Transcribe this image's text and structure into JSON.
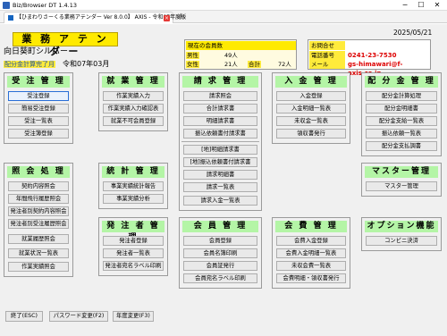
{
  "window": {
    "title": "Biz/Browser DT 1.4.13",
    "tab_label": "【ひまわりさーくる業務アテンダー Ver 8.0.0】 AXIS  -  令和07年度版",
    "new_tab": "+",
    "min": "─",
    "max": "☐",
    "close": "✕"
  },
  "header": {
    "logo": "業 務 ア テ ン ダ ー",
    "date": "2025/05/21",
    "org_name": "向日葵町シルバー",
    "finance_label": "配分金計算完了月",
    "finance_month": "令和07年03月"
  },
  "members": {
    "title": "現在の会員数",
    "male_label": "男性",
    "male_value": "49人",
    "female_label": "女性",
    "female_value": "21人",
    "total_label": "合計",
    "total_value": "72人"
  },
  "inquiry": {
    "title": "お問合せ",
    "phone_label": "電話番号",
    "phone_value": "0241-23-7530",
    "mail_label": "メール",
    "mail_value": "gs-himawari@f-axis.co.jp"
  },
  "sections": {
    "juchu": {
      "title": "受 注 管 理",
      "buttons": [
        "受注登録",
        "簡易受注登録",
        "受注一覧表",
        "受注簿登録"
      ]
    },
    "shugyo": {
      "title": "就 業 管 理",
      "buttons": [
        "作業実績入力",
        "作業実績入力確認表",
        "就業不可会員登録"
      ]
    },
    "seikyu": {
      "title": "請 求 管 理",
      "buttons": [
        "請求照会",
        "合計請求書",
        "明細請求書",
        "振込依頼書付請求書",
        "[地]明細請求書",
        "[地]振込依頼書付請求書",
        "請求明細書",
        "請求一覧表",
        "請求入金一覧表"
      ]
    },
    "nyukin": {
      "title": "入 金 管 理",
      "buttons": [
        "入金登録",
        "入金明細一覧表",
        "未収金一覧表",
        "領収書発行"
      ]
    },
    "haibun": {
      "title": "配 分 金 管 理",
      "buttons": [
        "配分金計算処理",
        "配分金明細書",
        "配分金支給一覧表",
        "振込依頼一覧表",
        "配分金支払調書"
      ]
    },
    "shokai": {
      "title": "照 会 処 理",
      "buttons": [
        "契約内容照会",
        "年間飛行履歴照会",
        "発注者別契約内容照会",
        "発注者別受注履歴照会",
        "就業履歴照会",
        "就業状況一覧表",
        "作業実績照会"
      ]
    },
    "tokei": {
      "title": "統 計 管 理",
      "buttons": [
        "事業実績統計報告",
        "事業実績分析"
      ]
    },
    "master": {
      "title": "マスター管理",
      "buttons": [
        "マスター管理"
      ]
    },
    "hatchu": {
      "title": "発 注 者 管 理",
      "buttons": [
        "発注者登録",
        "発注者一覧表",
        "発注者宛名ラベル印刷"
      ]
    },
    "kaiin": {
      "title": "会 員 管 理",
      "buttons": [
        "会員登録",
        "会員名簿印刷",
        "会員証発行",
        "会員宛名ラベル印刷"
      ]
    },
    "kaihi": {
      "title": "会 費 管 理",
      "buttons": [
        "会費入金登録",
        "会費入金明細一覧表",
        "未収会費一覧表",
        "会費明細・領収書発行"
      ]
    },
    "option": {
      "title": "オプション機能",
      "buttons": [
        "コンビニ決済"
      ]
    }
  },
  "footer": {
    "exit": "終了(ESC)",
    "password": "パスワード変更(F2)",
    "year": "年度変更(F3)"
  }
}
